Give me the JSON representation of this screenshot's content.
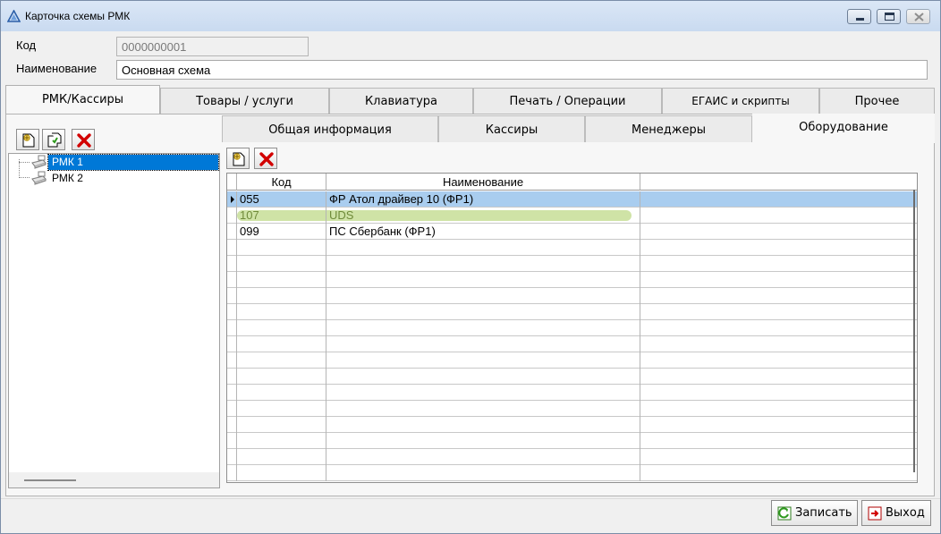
{
  "window": {
    "title": "Карточка схемы РМК"
  },
  "form": {
    "code_label": "Код",
    "code_value": "0000000001",
    "name_label": "Наименование",
    "name_value": "Основная схема"
  },
  "tabs": [
    {
      "label": "РМК/Кассиры",
      "active": true
    },
    {
      "label": "Товары / услуги",
      "active": false
    },
    {
      "label": "Клавиатура",
      "active": false
    },
    {
      "label": "Печать / Операции",
      "active": false
    },
    {
      "label": "ЕГАИС и скрипты",
      "active": false
    },
    {
      "label": "Прочее",
      "active": false
    }
  ],
  "tree": {
    "items": [
      {
        "label": "РМК 1",
        "selected": true
      },
      {
        "label": "РМК 2",
        "selected": false
      }
    ]
  },
  "subtabs": [
    {
      "label": "Общая информация",
      "active": false
    },
    {
      "label": "Кассиры",
      "active": false
    },
    {
      "label": "Менеджеры",
      "active": false
    },
    {
      "label": "Оборудование",
      "active": true
    }
  ],
  "grid": {
    "columns": [
      "Код",
      "Наименование"
    ],
    "rows": [
      {
        "code": "055",
        "name": "ФР Атол драйвер 10 (ФР1)",
        "selected": true
      },
      {
        "code": "107",
        "name": "UDS",
        "highlight": "#cfe3a6"
      },
      {
        "code": "099",
        "name": "ПС Сбербанк (ФР1)"
      }
    ]
  },
  "buttons": {
    "save": "Записать",
    "exit": "Выход"
  },
  "colors": {
    "selection": "#0078d7",
    "row_selected": "#a9cdef",
    "row_highlight": "#cfe3a6",
    "delete_red": "#d20000"
  }
}
